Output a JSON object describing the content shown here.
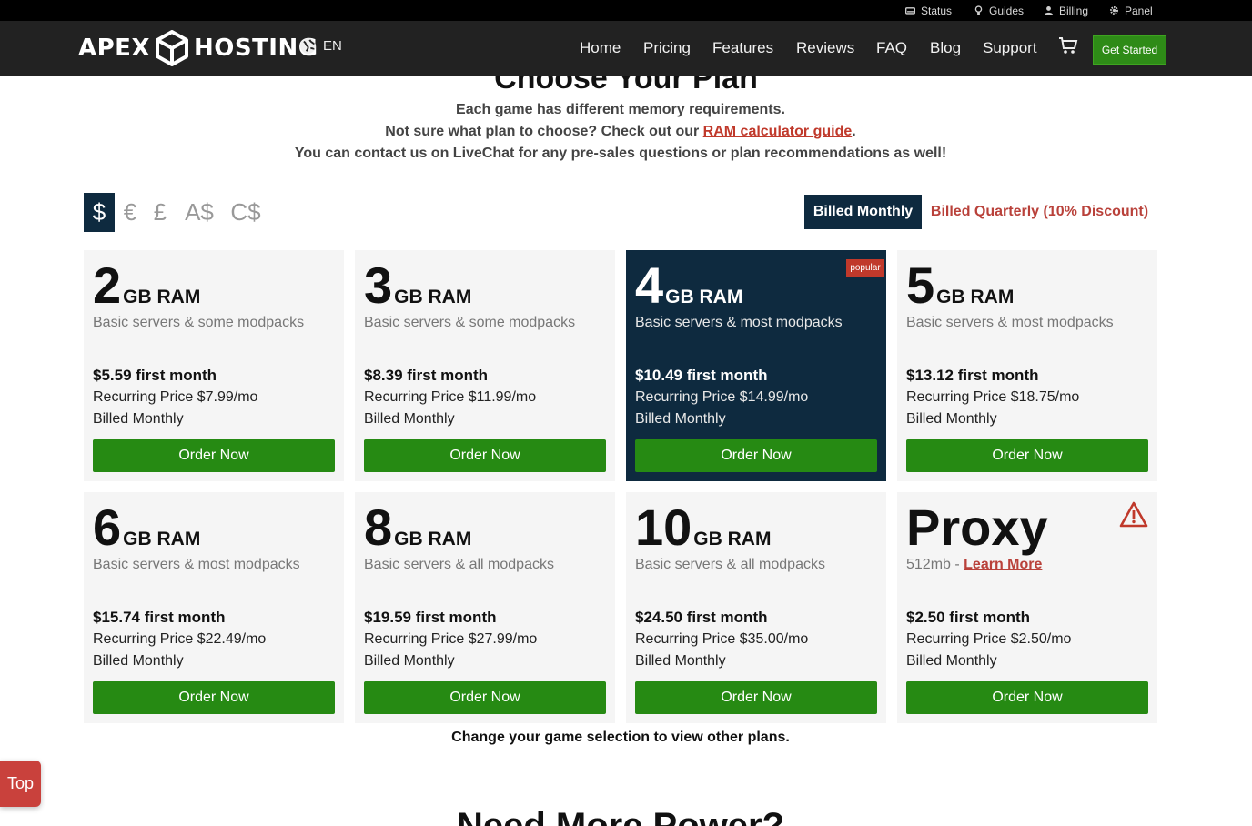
{
  "utility_bar": {
    "items": [
      {
        "label": "Status",
        "icon": "status-icon"
      },
      {
        "label": "Guides",
        "icon": "lightbulb-icon"
      },
      {
        "label": "Billing",
        "icon": "user-icon"
      },
      {
        "label": "Panel",
        "icon": "gear-icon"
      }
    ]
  },
  "navbar": {
    "logo_left": "APEX",
    "logo_right": "HOSTING",
    "language": "EN",
    "links": [
      "Home",
      "Pricing",
      "Features",
      "Reviews",
      "FAQ",
      "Blog",
      "Support"
    ],
    "cta": "Get Started"
  },
  "intro": {
    "heading": "Choose Your Plan",
    "line1": "Each game has different memory requirements.",
    "line2_prefix": "Not sure what plan to choose? Check out our ",
    "line2_link": "RAM calculator guide",
    "line2_suffix": ".",
    "line3": "You can contact us on LiveChat for any pre-sales questions or plan recommendations as well!"
  },
  "currencies": [
    "$",
    "€",
    "£",
    "A$",
    "C$"
  ],
  "selected_currency": "$",
  "billing": {
    "monthly_label": "Billed Monthly",
    "quarterly_label": "Billed Quarterly (10% Discount)",
    "selected": "monthly"
  },
  "plans": [
    {
      "ram": "2",
      "unit": "GB RAM",
      "desc": "Basic servers & some modpacks",
      "first": "$5.59 first month",
      "recurring": "Recurring Price $7.99/mo",
      "billed": "Billed Monthly",
      "button": "Order Now"
    },
    {
      "ram": "3",
      "unit": "GB RAM",
      "desc": "Basic servers & some modpacks",
      "first": "$8.39 first month",
      "recurring": "Recurring Price $11.99/mo",
      "billed": "Billed Monthly",
      "button": "Order Now"
    },
    {
      "ram": "4",
      "unit": "GB RAM",
      "desc": "Basic servers & most modpacks",
      "first": "$10.49 first month",
      "recurring": "Recurring Price $14.99/mo",
      "billed": "Billed Monthly",
      "button": "Order Now",
      "badge": "popular"
    },
    {
      "ram": "5",
      "unit": "GB RAM",
      "desc": "Basic servers & most modpacks",
      "first": "$13.12 first month",
      "recurring": "Recurring Price $18.75/mo",
      "billed": "Billed Monthly",
      "button": "Order Now"
    },
    {
      "ram": "6",
      "unit": "GB RAM",
      "desc": "Basic servers & most modpacks",
      "first": "$15.74 first month",
      "recurring": "Recurring Price $22.49/mo",
      "billed": "Billed Monthly",
      "button": "Order Now"
    },
    {
      "ram": "8",
      "unit": "GB RAM",
      "desc": "Basic servers & all modpacks",
      "first": "$19.59 first month",
      "recurring": "Recurring Price $27.99/mo",
      "billed": "Billed Monthly",
      "button": "Order Now"
    },
    {
      "ram": "10",
      "unit": "GB RAM",
      "desc": "Basic servers & all modpacks",
      "first": "$24.50 first month",
      "recurring": "Recurring Price $35.00/mo",
      "billed": "Billed Monthly",
      "button": "Order Now"
    }
  ],
  "proxy": {
    "title": "Proxy",
    "desc_prefix": "512mb - ",
    "desc_link": "Learn More",
    "first": "$2.50 first month",
    "recurring": "Recurring Price $2.50/mo",
    "billed": "Billed Monthly",
    "button": "Order Now"
  },
  "change_note": "Change your game selection to view other plans.",
  "top_button": "Top",
  "next_heading": "Need More Power?",
  "colors": {
    "navy": "#0e2a3f",
    "green": "#268a13",
    "red_accent": "#c0392b",
    "card_bg": "#f5f5f5"
  }
}
